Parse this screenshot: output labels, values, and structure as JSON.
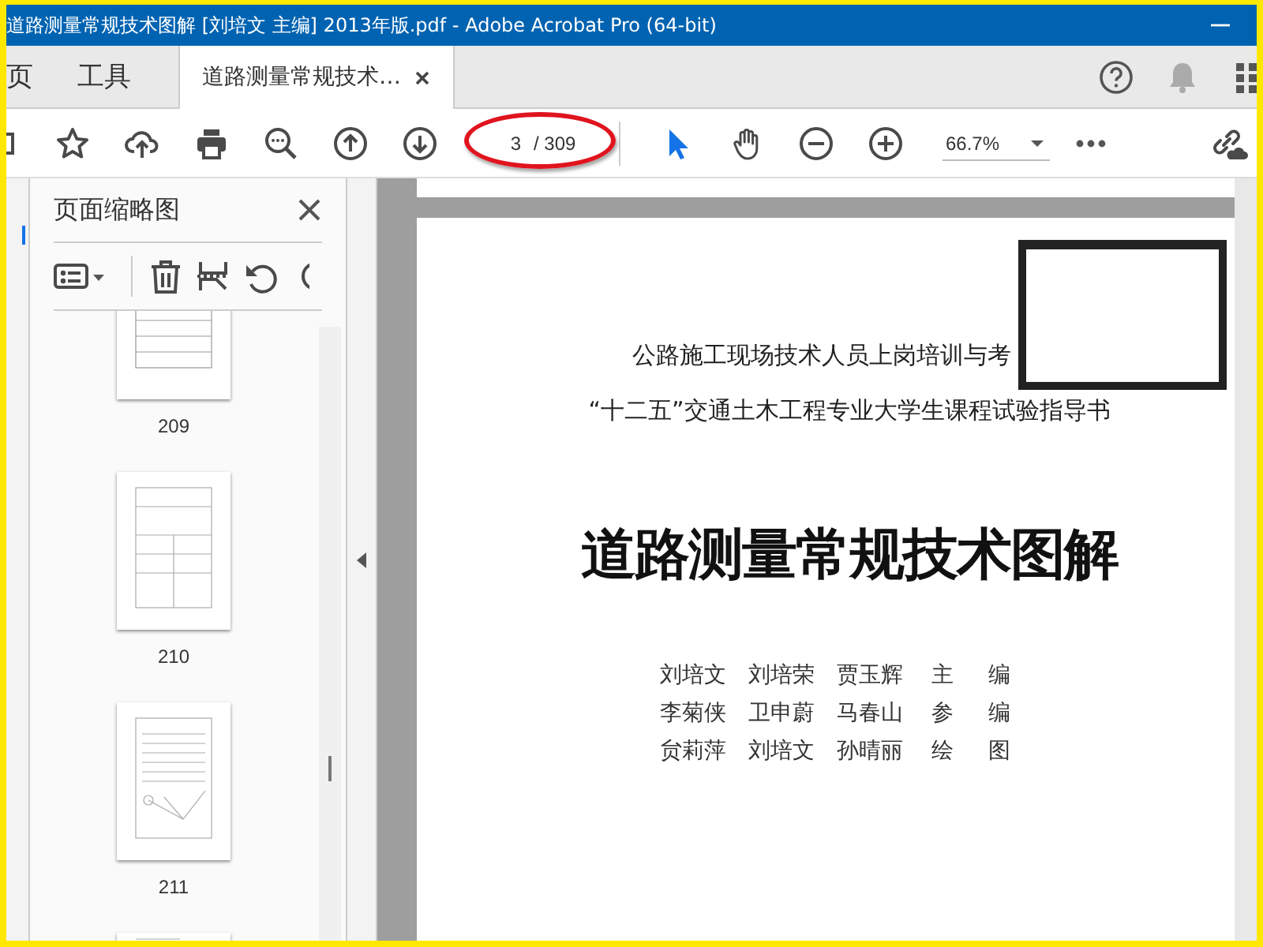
{
  "window": {
    "title": "道路测量常规技术图解 [刘培文 主编] 2013年版.pdf - Adobe Acrobat Pro (64-bit)"
  },
  "tabs": [
    {
      "label": "页",
      "selected": false,
      "closable": false
    },
    {
      "label": "工具",
      "selected": false,
      "closable": false
    },
    {
      "label": "道路测量常规技术…",
      "selected": true,
      "closable": true
    }
  ],
  "toolbar": {
    "page_number": "3",
    "page_total": "/ 309",
    "zoom": "66.7%"
  },
  "sidebar": {
    "title": "页面缩略图",
    "thumbnails": [
      {
        "kind": "table",
        "label": "209"
      },
      {
        "kind": "form",
        "label": "210"
      },
      {
        "kind": "figure",
        "label": "211"
      },
      {
        "kind": "partial"
      }
    ]
  },
  "document": {
    "subtitle_lines": [
      "公路施工现场技术人员上岗培训与考",
      "“十二五”交通土木工程专业大学生课程试验指导书"
    ],
    "title": "道路测量常规技术图解",
    "credits": [
      [
        "刘培文",
        "刘培荣",
        "贾玉辉",
        "主",
        "编"
      ],
      [
        "李菊侠",
        "卫申蔚",
        "马春山",
        "参",
        "编"
      ],
      [
        "贠莉萍",
        "刘培文",
        "孙晴丽",
        "绘",
        "图"
      ]
    ]
  }
}
